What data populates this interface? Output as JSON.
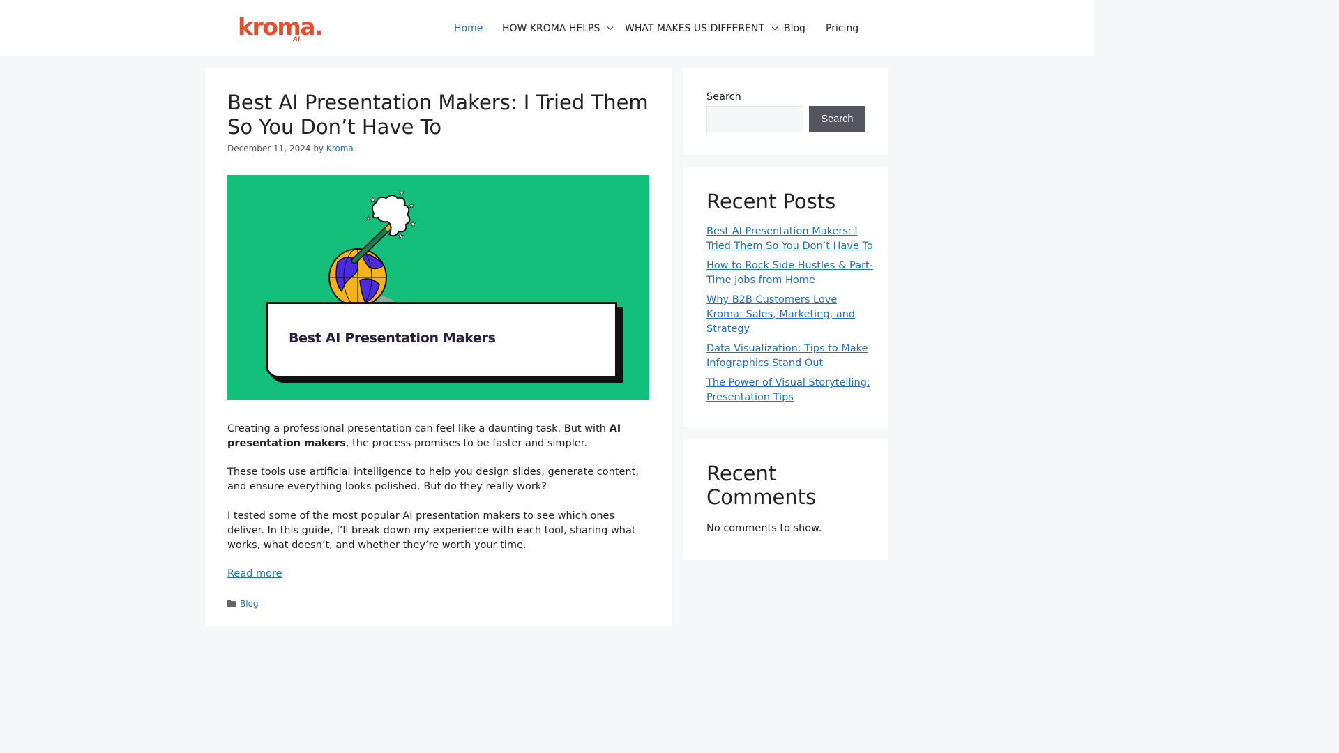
{
  "header": {
    "logo_text": "kroma.",
    "logo_sub": "AI",
    "brand_color": "#e2502f",
    "nav": [
      {
        "label": "Home",
        "active": true,
        "dropdown": false
      },
      {
        "label": "HOW KROMA HELPS",
        "active": false,
        "dropdown": true
      },
      {
        "label": "WHAT MAKES US DIFFERENT",
        "active": false,
        "dropdown": true
      },
      {
        "label": "Blog",
        "active": false,
        "dropdown": false
      },
      {
        "label": "Pricing",
        "active": false,
        "dropdown": false
      }
    ]
  },
  "article": {
    "title": "Best AI Presentation Makers: I Tried Them So You Don’t Have To",
    "date": "December 11, 2024",
    "by": "by",
    "author": "Kroma",
    "hero_caption": "Best AI Presentation Makers",
    "hero_bg": "#14bf7c",
    "para1_start": "Creating a professional presentation can feel like a daunting task. But with ",
    "para1_bold": "AI presentation makers",
    "para1_end": ", the process promises to be faster and simpler.",
    "para2": "These tools use artificial intelligence to help you design slides, generate content, and ensure everything looks polished. But do they really work?",
    "para3": "I tested some of the most popular AI presentation makers to see which ones deliver. In this guide, I’ll break down my experience with each tool, sharing what works, what doesn’t, and whether they’re worth your time.",
    "read_more": "Read more",
    "category": "Blog"
  },
  "sidebar": {
    "search_label": "Search",
    "search_button": "Search",
    "search_value": "",
    "recent_posts_title": "Recent Posts",
    "recent_posts": [
      "Best AI Presentation Makers: I Tried Them So You Don’t Have To",
      "How to Rock Side Hustles & Part-Time Jobs from Home",
      "Why B2B Customers Love Kroma: Sales, Marketing, and Strategy",
      "Data Visualization: Tips to Make Infographics Stand Out",
      "The Power of Visual Storytelling: Presentation Tips"
    ],
    "recent_comments_title": "Recent Comments",
    "no_comments": "No comments to show."
  }
}
